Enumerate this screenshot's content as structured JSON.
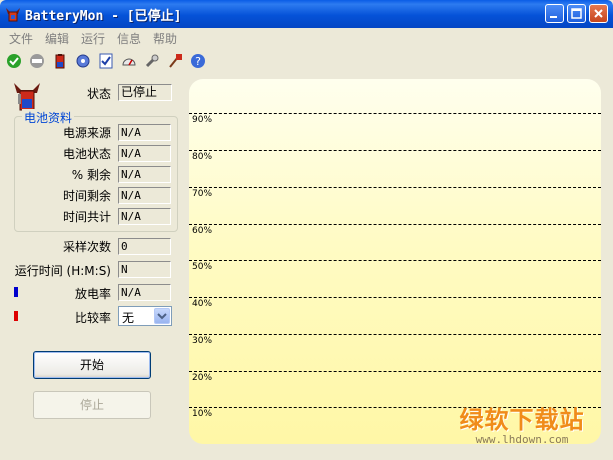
{
  "window": {
    "title": "BatteryMon - [已停止]"
  },
  "menu": [
    "文件",
    "编辑",
    "运行",
    "信息",
    "帮助"
  ],
  "toolbar": [
    "check-icon",
    "stop-icon",
    "battery-icon",
    "settings-icon",
    "checklist-icon",
    "gauge-icon",
    "tools-icon",
    "wizard-icon",
    "help-icon"
  ],
  "status": {
    "label": "状态",
    "value": "已停止"
  },
  "battery_group": {
    "title": "电池资料",
    "rows": [
      {
        "label": "电源来源",
        "value": "N/A"
      },
      {
        "label": "电池状态",
        "value": "N/A"
      },
      {
        "label": "% 剩余",
        "value": "N/A"
      },
      {
        "label": "时间剩余",
        "value": "N/A"
      },
      {
        "label": "时间共计",
        "value": "N/A"
      }
    ]
  },
  "samples": {
    "label": "采样次数",
    "value": "0"
  },
  "runtime": {
    "label": "运行时间 (H:M:S)",
    "value": "N"
  },
  "discharge": {
    "label": "放电率",
    "value": "N/A",
    "color": "#0000cc"
  },
  "compare": {
    "label": "比较率",
    "selected": "无",
    "color": "#dd0000"
  },
  "buttons": {
    "start": "开始",
    "stop": "停止"
  },
  "chart": {
    "ticks": [
      "90%",
      "80%",
      "70%",
      "60%",
      "50%",
      "40%",
      "30%",
      "20%",
      "10%"
    ]
  },
  "watermark": {
    "brand": "绿软下载站",
    "url": "www.lhdown.com"
  }
}
